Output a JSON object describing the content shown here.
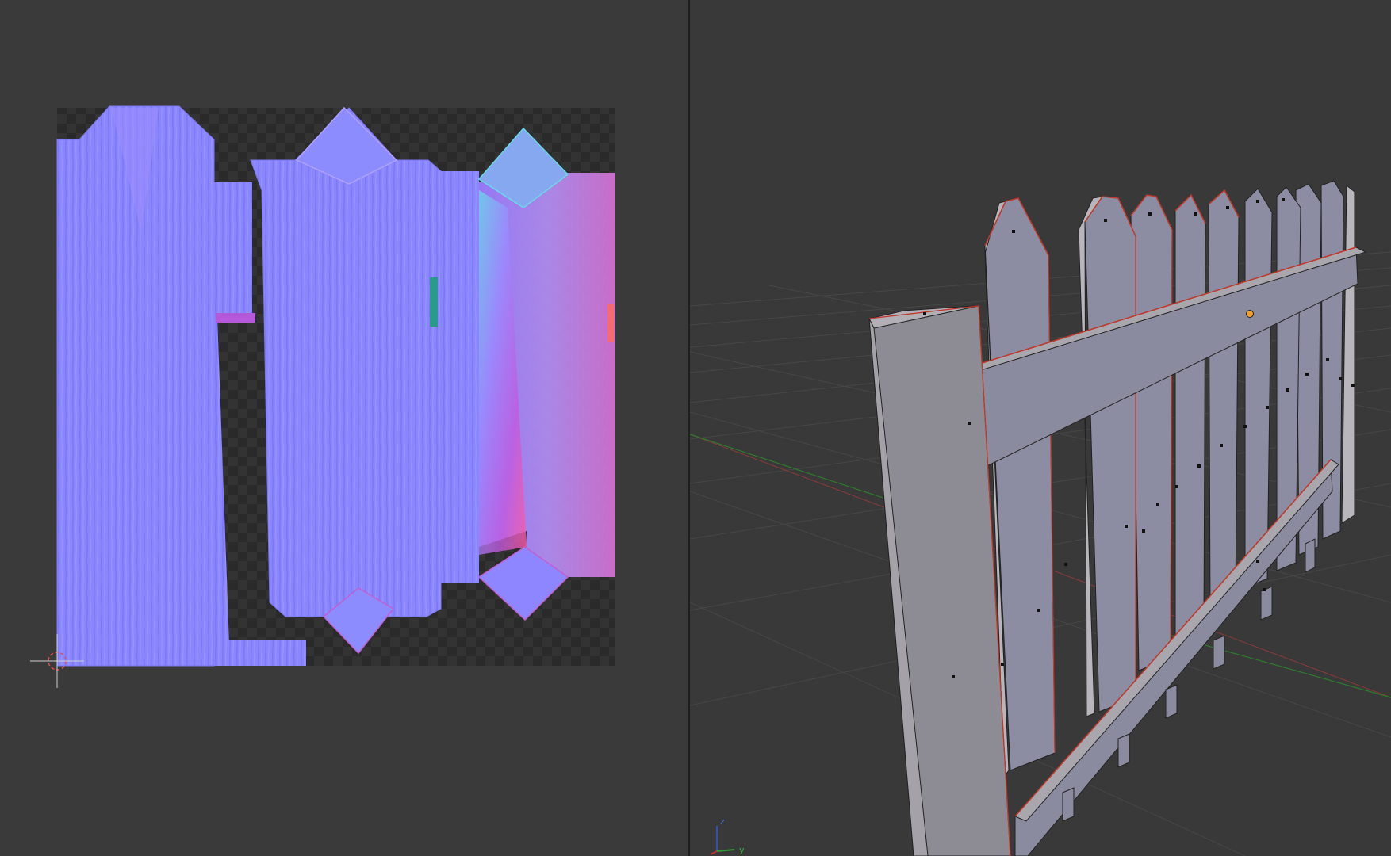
{
  "uv_editor": {
    "image": "normal-map-texture",
    "cursor_icon": "2d-cursor-icon"
  },
  "viewport": {
    "object": "picket-fence-mesh",
    "axis_gizmo": {
      "z_label": "z",
      "y_label": "y"
    },
    "pivot_icon": "origin-dot-icon"
  },
  "colors": {
    "background": "#393939",
    "normal_map_base": "#8080ff",
    "fence_face": "#8b8ba0",
    "fence_side": "#a9a7ad",
    "selected_edge": "#c0392b",
    "x_axis": "#6b2e2e",
    "y_axis": "#2e7d2e",
    "z_axis": "#3050c0"
  }
}
